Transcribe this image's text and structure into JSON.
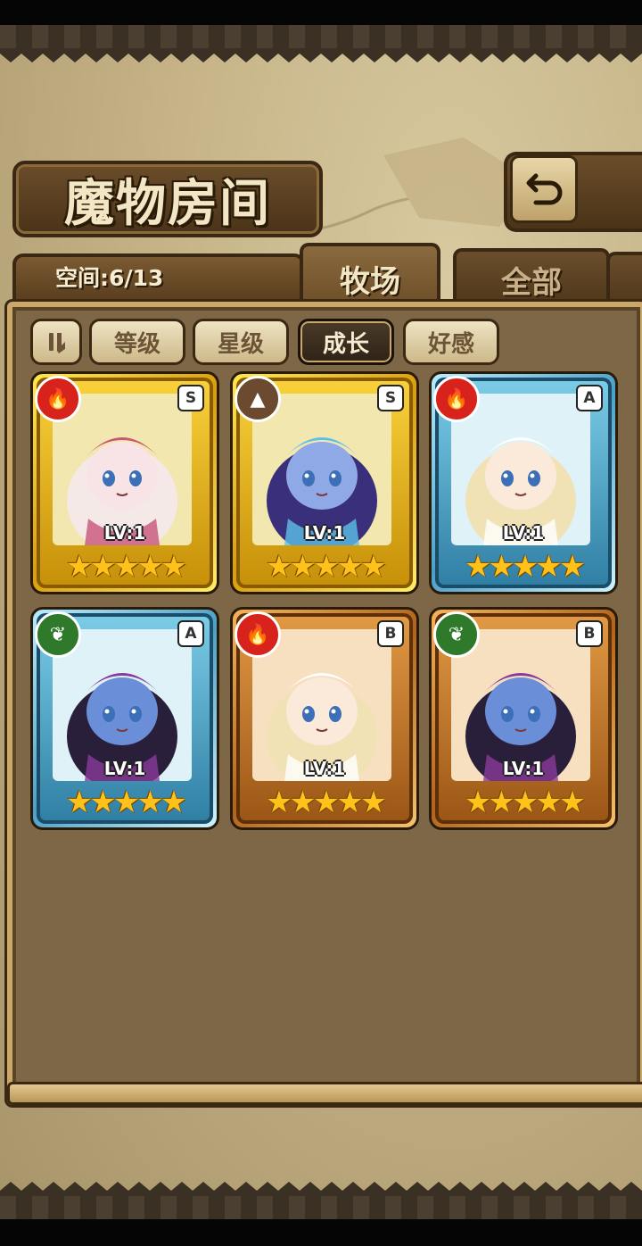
{
  "header": {
    "title": "魔物房间",
    "back_icon": "return-arrow-icon"
  },
  "space": {
    "label": "空间:6/13"
  },
  "tabs": [
    {
      "label": "牧场",
      "active": true
    },
    {
      "label": "全部",
      "active": false
    }
  ],
  "sort_toggle_icon": "pause-sort-icon",
  "filters": [
    {
      "label": "等级",
      "active": false
    },
    {
      "label": "星级",
      "active": false
    },
    {
      "label": "成长",
      "active": true
    },
    {
      "label": "好感",
      "active": false
    }
  ],
  "monsters": [
    {
      "level": "LV:1",
      "rank": "S",
      "element": "fire",
      "element_color": "#d8231c",
      "frame": "gold",
      "stars": "★★★★★",
      "hair": "#f4e9e6",
      "skin": "#f8e4e6",
      "accent": "#c8557a"
    },
    {
      "level": "LV:1",
      "rank": "S",
      "element": "earth",
      "element_color": "#6b4a30",
      "frame": "gold",
      "stars": "★★★★★",
      "hair": "#3a2f7a",
      "skin": "#8fa8e6",
      "accent": "#5cc0e8"
    },
    {
      "level": "LV:1",
      "rank": "A",
      "element": "fire",
      "element_color": "#d8231c",
      "frame": "blue",
      "stars": "★★★★★",
      "hair": "#f1e2b6",
      "skin": "#fbe9da",
      "accent": "#ffffff"
    },
    {
      "level": "LV:1",
      "rank": "A",
      "element": "wind",
      "element_color": "#2e7a2a",
      "frame": "blue",
      "stars": "★★★★★",
      "hair": "#2a1f3a",
      "skin": "#6a8ed8",
      "accent": "#8a3a9a"
    },
    {
      "level": "LV:1",
      "rank": "B",
      "element": "fire",
      "element_color": "#d8231c",
      "frame": "bronze",
      "stars": "★★★★★",
      "hair": "#f1e2b6",
      "skin": "#fbe9da",
      "accent": "#ffffff"
    },
    {
      "level": "LV:1",
      "rank": "B",
      "element": "wind",
      "element_color": "#2e7a2a",
      "frame": "bronze",
      "stars": "★★★★★",
      "hair": "#2a1f3a",
      "skin": "#6a8ed8",
      "accent": "#8a3a9a"
    }
  ]
}
